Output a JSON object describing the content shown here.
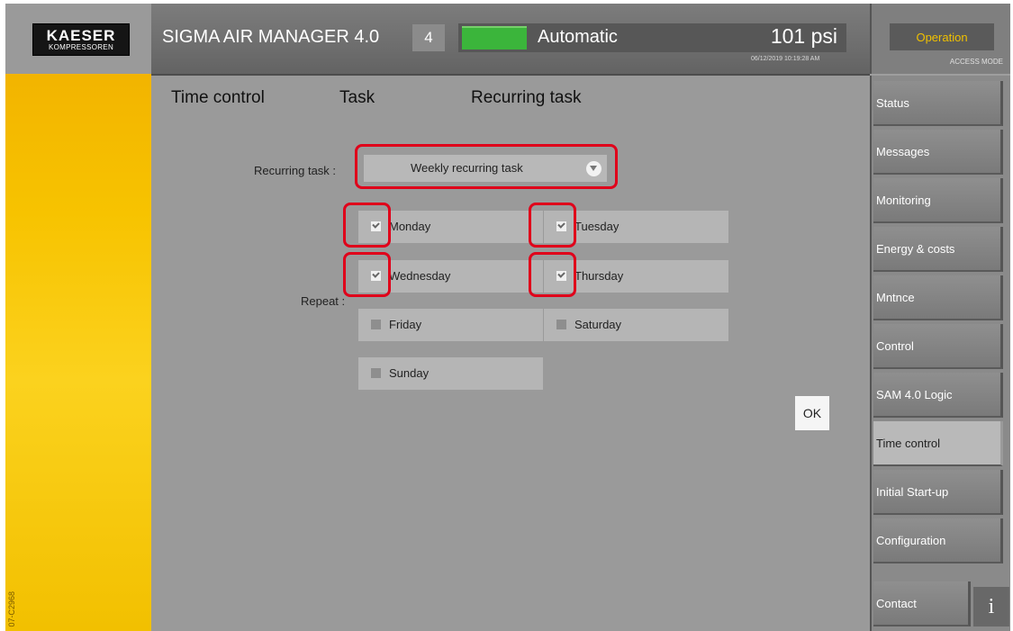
{
  "header": {
    "logo_line1": "KAESER",
    "logo_line2": "KOMPRESSOREN",
    "title": "SIGMA AIR MANAGER 4.0",
    "unit_number": "4",
    "mode": "Automatic",
    "pressure": "101 psi",
    "datetime": "06/12/2019 10:19:28 AM",
    "operation_label": "Operation",
    "access_mode": "ACCESS MODE",
    "status_led_color": "#3bb53b"
  },
  "breadcrumb": {
    "level1": "Time control",
    "level2": "Task",
    "level3": "Recurring task"
  },
  "form": {
    "recurring_label": "Recurring task :",
    "recurring_value": "Weekly recurring task",
    "repeat_label": "Repeat :",
    "days": {
      "monday": {
        "label": "Monday",
        "checked": true
      },
      "tuesday": {
        "label": "Tuesday",
        "checked": true
      },
      "wednesday": {
        "label": "Wednesday",
        "checked": true
      },
      "thursday": {
        "label": "Thursday",
        "checked": true
      },
      "friday": {
        "label": "Friday",
        "checked": false
      },
      "saturday": {
        "label": "Saturday",
        "checked": false
      },
      "sunday": {
        "label": "Sunday",
        "checked": false
      }
    },
    "ok_label": "OK",
    "highlight_color": "#e0001a"
  },
  "nav": {
    "items": [
      "Status",
      "Messages",
      "Monitoring",
      "Energy & costs",
      "Mntnce",
      "Control",
      "SAM 4.0 Logic",
      "Time control",
      "Initial Start-up",
      "Configuration",
      "Contact"
    ],
    "active": "Time control",
    "info_icon": "i"
  },
  "doc_id": "07-C2968"
}
